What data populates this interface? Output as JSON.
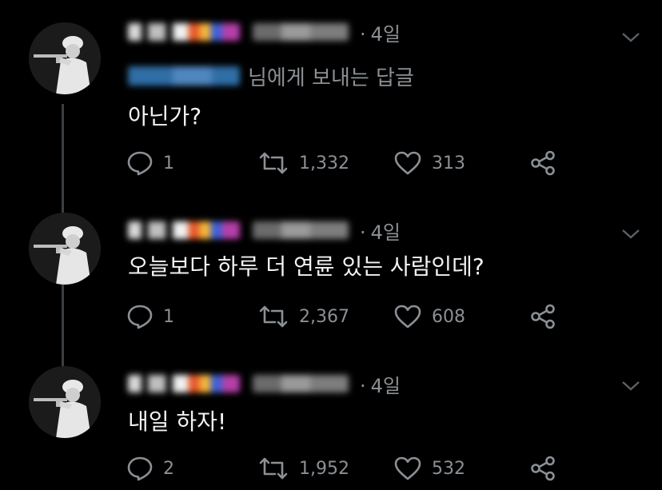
{
  "tweets": [
    {
      "time": "4일",
      "reply_to_label": "님에게 보내는 답글",
      "text": "아닌가?",
      "replies": "1",
      "retweets": "1,332",
      "likes": "313"
    },
    {
      "time": "4일",
      "text": "오늘보다 하루 더 연륜 있는 사람인데?",
      "replies": "1",
      "retweets": "2,367",
      "likes": "608"
    },
    {
      "time": "4일",
      "text": "내일 하자!",
      "replies": "2",
      "retweets": "1,952",
      "likes": "532"
    }
  ],
  "separator": "·",
  "colors": {
    "background": "#000000",
    "text": "#f2f2f2",
    "secondary": "#8b9095",
    "thread_line": "#3a3f44"
  },
  "icons": [
    "reply-icon",
    "retweet-icon",
    "like-icon",
    "share-icon",
    "chevron-down-icon"
  ]
}
